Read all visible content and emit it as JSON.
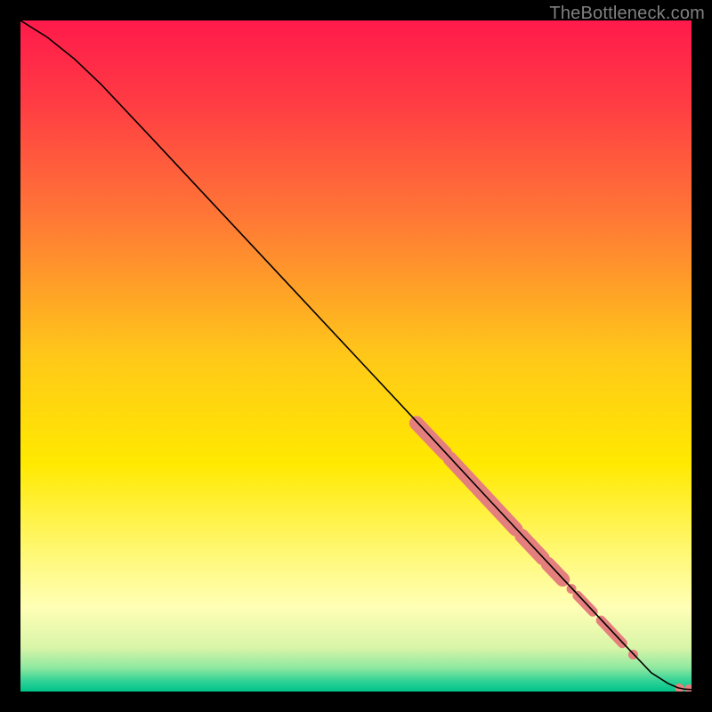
{
  "attribution": "TheBottleneck.com",
  "chart_data": {
    "type": "line",
    "title": "",
    "xlabel": "",
    "ylabel": "",
    "xlim": [
      0,
      100
    ],
    "ylim": [
      0,
      100
    ],
    "grid": false,
    "legend": false,
    "background_gradient_stops": [
      {
        "pos": 0.0,
        "color": "#ff1a4b"
      },
      {
        "pos": 0.12,
        "color": "#ff3b44"
      },
      {
        "pos": 0.3,
        "color": "#ff7a35"
      },
      {
        "pos": 0.5,
        "color": "#ffc819"
      },
      {
        "pos": 0.66,
        "color": "#ffe900"
      },
      {
        "pos": 0.8,
        "color": "#fff97a"
      },
      {
        "pos": 0.875,
        "color": "#ffffb6"
      },
      {
        "pos": 0.935,
        "color": "#d8f5a8"
      },
      {
        "pos": 0.965,
        "color": "#8de8a0"
      },
      {
        "pos": 0.985,
        "color": "#2ed196"
      },
      {
        "pos": 1.0,
        "color": "#00c389"
      }
    ],
    "series": [
      {
        "name": "curve",
        "stroke": "#000000",
        "points": [
          {
            "x": 0.0,
            "y": 100.0
          },
          {
            "x": 4.0,
            "y": 97.5
          },
          {
            "x": 8.0,
            "y": 94.3
          },
          {
            "x": 12.0,
            "y": 90.5
          },
          {
            "x": 20.0,
            "y": 82.0
          },
          {
            "x": 30.0,
            "y": 71.3
          },
          {
            "x": 40.0,
            "y": 60.6
          },
          {
            "x": 50.0,
            "y": 49.9
          },
          {
            "x": 60.0,
            "y": 39.2
          },
          {
            "x": 70.0,
            "y": 28.4
          },
          {
            "x": 80.0,
            "y": 17.7
          },
          {
            "x": 90.0,
            "y": 7.0
          },
          {
            "x": 94.0,
            "y": 2.8
          },
          {
            "x": 96.5,
            "y": 1.2
          },
          {
            "x": 98.0,
            "y": 0.55
          },
          {
            "x": 99.0,
            "y": 0.35
          },
          {
            "x": 100.0,
            "y": 0.3
          }
        ]
      }
    ],
    "marker_segments": {
      "color": "#e57f7d",
      "radius_thick": 8,
      "radius_thin": 5.5,
      "segments": [
        {
          "x0": 59.0,
          "y0": 40.0,
          "x1": 63.3,
          "y1": 35.5,
          "r": 8
        },
        {
          "x0": 64.0,
          "y0": 34.7,
          "x1": 73.8,
          "y1": 24.2,
          "r": 8
        },
        {
          "x0": 74.7,
          "y0": 23.2,
          "x1": 77.8,
          "y1": 19.9,
          "r": 8
        },
        {
          "x0": 78.6,
          "y0": 19.0,
          "x1": 80.8,
          "y1": 16.7,
          "r": 8
        },
        {
          "x0": 83.0,
          "y0": 14.3,
          "x1": 85.3,
          "y1": 11.9,
          "r": 5.5
        },
        {
          "x0": 86.5,
          "y0": 10.6,
          "x1": 89.7,
          "y1": 7.2,
          "r": 5.5
        }
      ],
      "dots": [
        {
          "x": 82.1,
          "y": 15.3,
          "r": 5.5
        },
        {
          "x": 91.3,
          "y": 5.5,
          "r": 5.5
        },
        {
          "x": 98.2,
          "y": 0.55,
          "r": 5.0
        },
        {
          "x": 99.6,
          "y": 0.4,
          "r": 5.0
        }
      ]
    }
  }
}
